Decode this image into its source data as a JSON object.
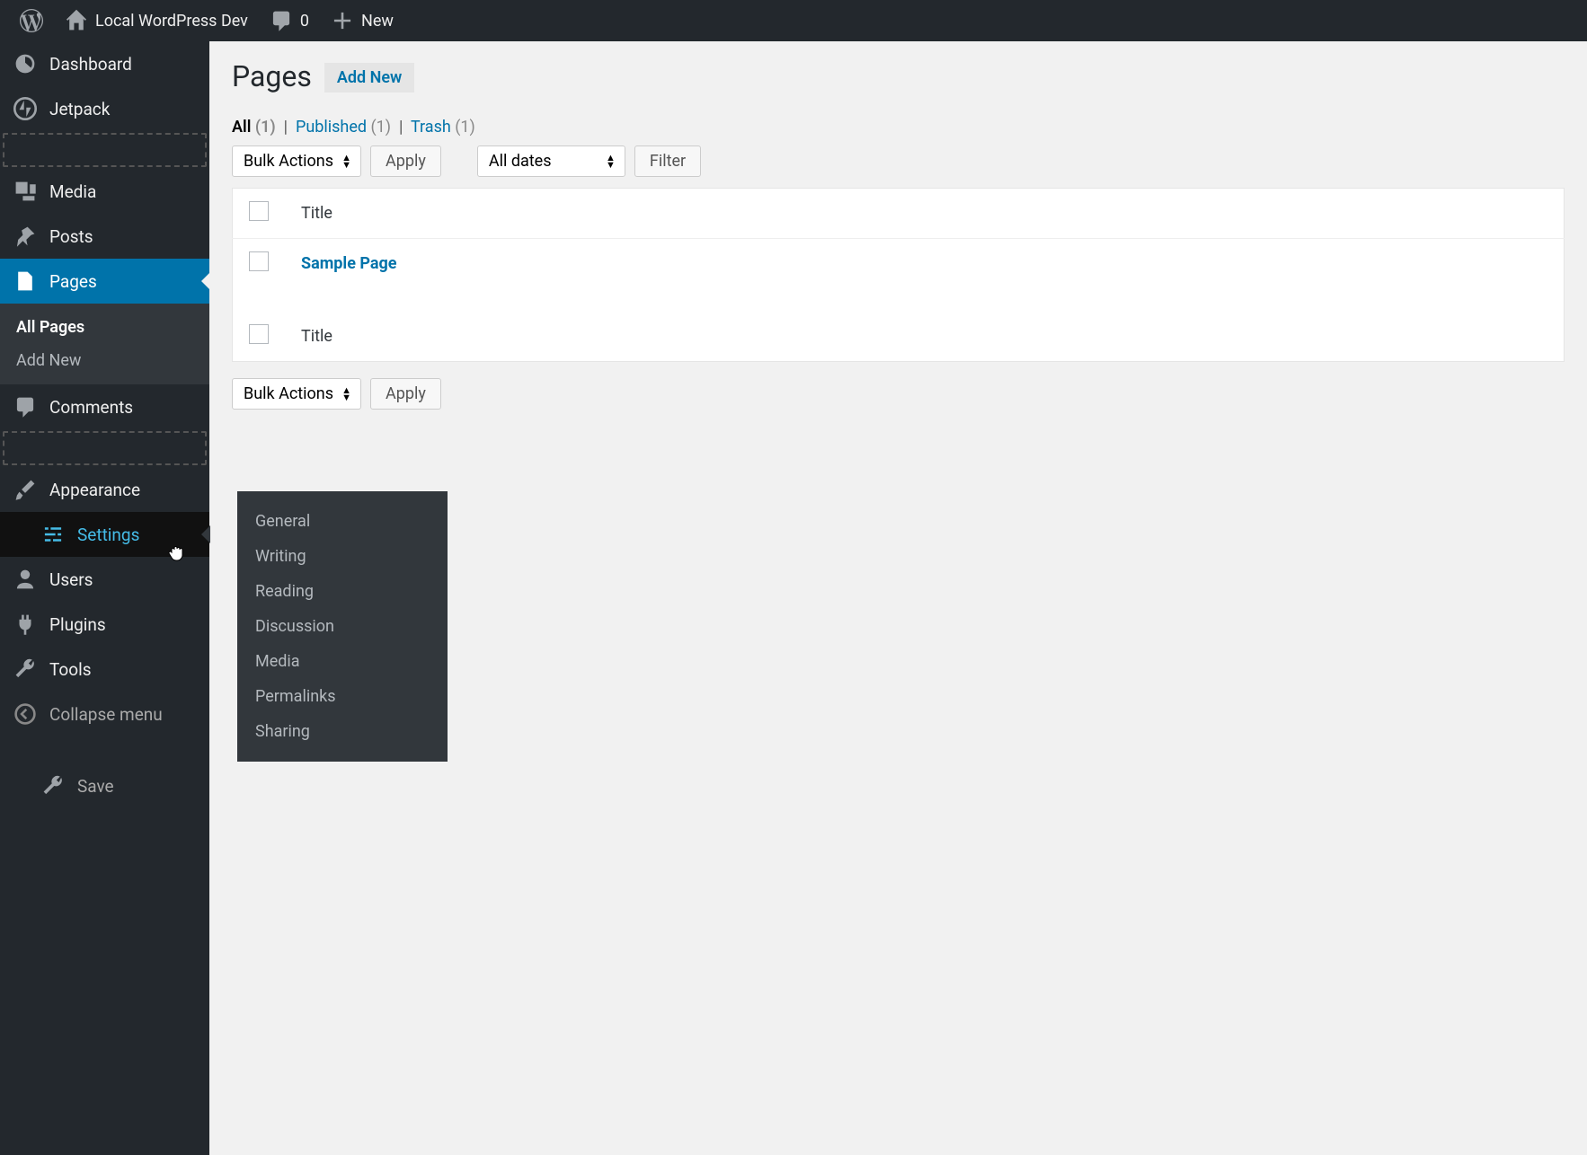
{
  "adminbar": {
    "site_name": "Local WordPress Dev",
    "comment_count": "0",
    "new_label": "New"
  },
  "sidebar": {
    "dashboard": "Dashboard",
    "jetpack": "Jetpack",
    "media": "Media",
    "posts": "Posts",
    "pages": "Pages",
    "pages_sub": {
      "all": "All Pages",
      "add": "Add New"
    },
    "comments": "Comments",
    "appearance": "Appearance",
    "settings": "Settings",
    "users": "Users",
    "plugins": "Plugins",
    "tools": "Tools",
    "collapse": "Collapse menu",
    "save": "Save"
  },
  "settings_flyout": {
    "items": [
      "General",
      "Writing",
      "Reading",
      "Discussion",
      "Media",
      "Permalinks",
      "Sharing"
    ]
  },
  "page": {
    "title": "Pages",
    "add_new": "Add New",
    "filters": {
      "all": "All",
      "all_count": "(1)",
      "published": "Published",
      "published_count": "(1)",
      "trash": "Trash",
      "trash_count": "(1)"
    },
    "bulk_actions": "Bulk Actions",
    "apply": "Apply",
    "all_dates": "All dates",
    "filter": "Filter",
    "title_col": "Title",
    "rows": [
      {
        "title": "Sample Page"
      }
    ]
  }
}
